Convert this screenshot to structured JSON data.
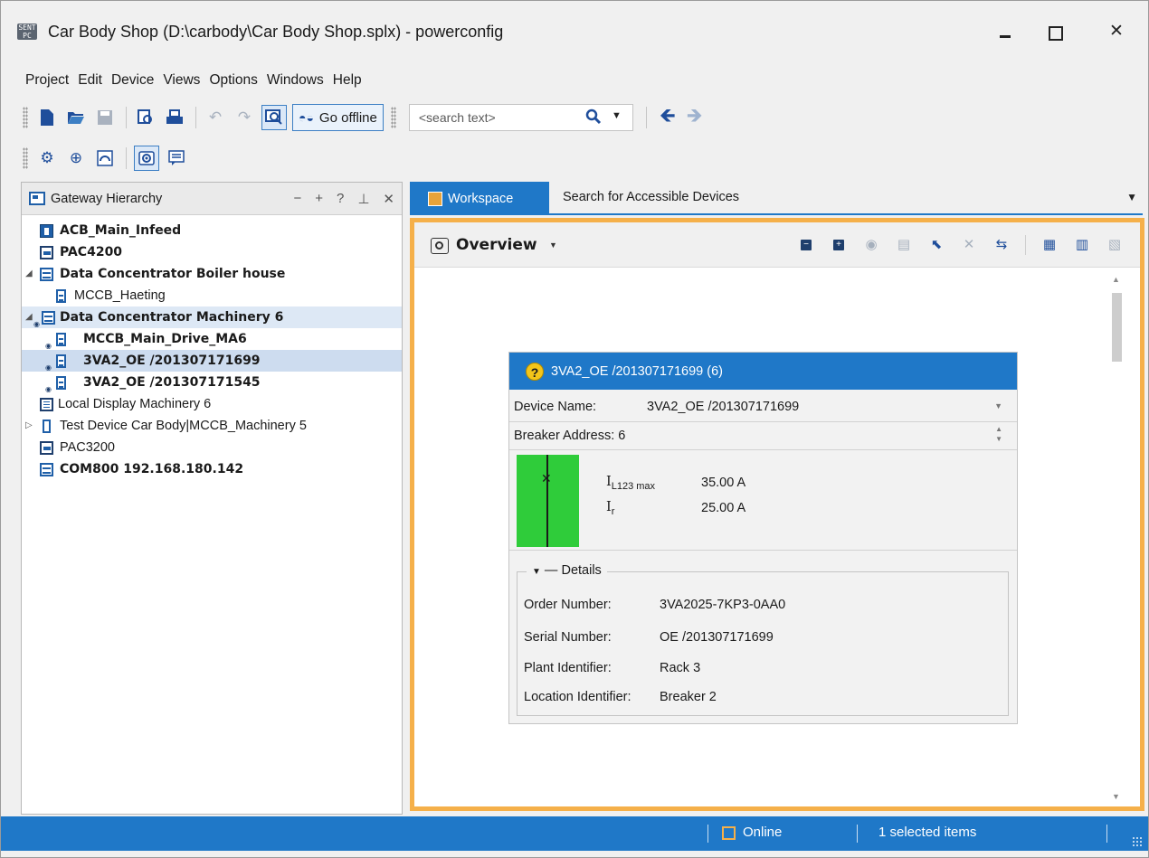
{
  "window": {
    "title": "Car Body Shop (D:\\carbody\\Car Body Shop.splx) - powerconfig",
    "app_icon_text": "SENT PC"
  },
  "menu": [
    "Project",
    "Edit",
    "Device",
    "Views",
    "Options",
    "Windows",
    "Help"
  ],
  "toolbar": {
    "go_offline_label": "Go offline",
    "search_placeholder": "<search text>"
  },
  "left_panel": {
    "title": "Gateway Hierarchy",
    "tree": [
      {
        "label": "ACB_Main_Infeed",
        "icon": "acb-icon",
        "bold": true,
        "level": 0
      },
      {
        "label": "PAC4200",
        "icon": "pac-meter-icon",
        "bold": true,
        "level": 0
      },
      {
        "label": "Data Concentrator Boiler house",
        "icon": "data-concentrator-icon",
        "bold": true,
        "level": 0,
        "expanded": true
      },
      {
        "label": "MCCB_Haeting",
        "icon": "mccb-icon",
        "bold": false,
        "level": 1
      },
      {
        "label": "Data Concentrator Machinery 6",
        "icon": "data-concentrator-icon",
        "bold": true,
        "level": 0,
        "expanded": true
      },
      {
        "label": "MCCB_Main_Drive_MA6",
        "icon": "mccb-icon",
        "bold": true,
        "level": 1
      },
      {
        "label": "3VA2_OE /201307171699",
        "icon": "mccb-icon",
        "bold": true,
        "level": 1,
        "selected": true
      },
      {
        "label": "3VA2_OE /201307171545",
        "icon": "mccb-icon",
        "bold": true,
        "level": 1
      },
      {
        "label": "Local Display Machinery 6",
        "icon": "display-icon",
        "bold": false,
        "level": 0
      },
      {
        "label": "Test Device Car Body|MCCB_Machinery 5",
        "icon": "test-device-icon",
        "bold": false,
        "level": 0,
        "expanded": false
      },
      {
        "label": "PAC3200",
        "icon": "pac-meter-icon",
        "bold": false,
        "level": 0
      },
      {
        "label": "COM800 192.168.180.142",
        "icon": "data-concentrator-icon",
        "bold": true,
        "level": 0
      }
    ]
  },
  "tabs": {
    "active": "Workspace",
    "inactive": "Search for Accessible Devices"
  },
  "overview": {
    "title": "Overview"
  },
  "device_card": {
    "header": "3VA2_OE /201307171699 (6)",
    "device_name_label": "Device Name:",
    "device_name_value": "3VA2_OE /201307171699",
    "breaker_address_label": "Breaker Address:",
    "breaker_address_value": "6",
    "measurements": [
      {
        "symbol": "I",
        "sub": "L123 max",
        "value": "35.00 A"
      },
      {
        "symbol": "I",
        "sub": "r",
        "value": "25.00 A"
      }
    ],
    "details_label": "Details",
    "details": [
      {
        "label": "Order Number:",
        "value": "3VA2025-7KP3-0AA0"
      },
      {
        "label": "Serial Number:",
        "value": "OE /201307171699"
      },
      {
        "label": "Plant Identifier:",
        "value": "Rack 3"
      },
      {
        "label": "Location Identifier:",
        "value": "Breaker 2"
      }
    ]
  },
  "statusbar": {
    "online": "Online",
    "selected": "1 selected items"
  },
  "colors": {
    "accent_blue": "#1f78c8",
    "workspace_border": "#f5b04a",
    "breaker_green": "#2fcc3a"
  }
}
